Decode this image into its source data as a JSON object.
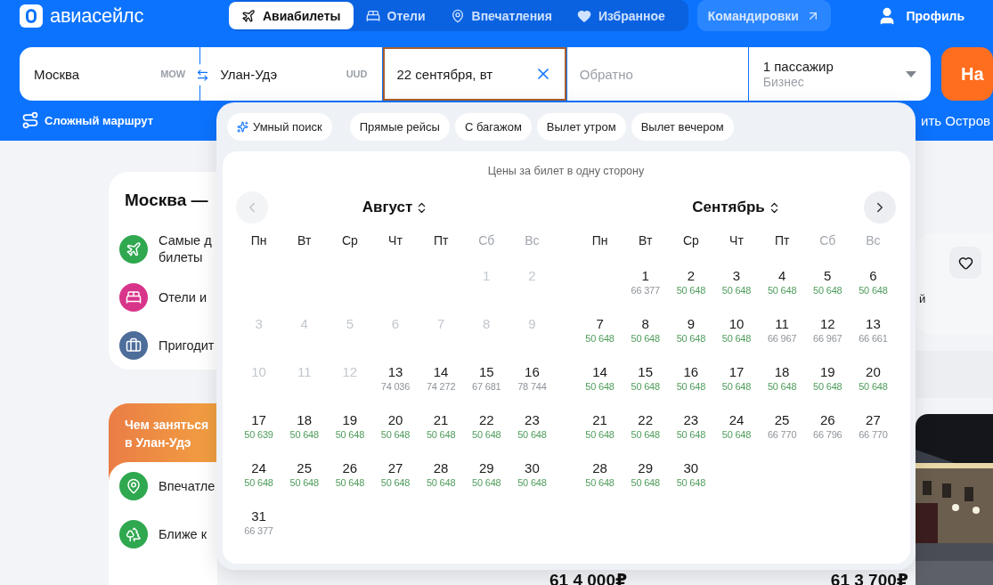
{
  "header": {
    "logo": "авиасейлс",
    "nav": [
      {
        "label": "Авиабилеты",
        "selected": true
      },
      {
        "label": "Отели",
        "selected": false
      },
      {
        "label": "Впечатления",
        "selected": false
      },
      {
        "label": "Избранное",
        "selected": false
      }
    ],
    "business_link": "Командировки",
    "profile": "Профиль"
  },
  "search": {
    "origin": {
      "value": "Москва",
      "code": "MOW"
    },
    "destination": {
      "value": "Улан-Удэ",
      "code": "UUD"
    },
    "depart": {
      "value": "22 сентября, вт",
      "active": true
    },
    "return": {
      "placeholder": "Обратно"
    },
    "passengers": {
      "value": "1 пассажир",
      "cabin": "Бизнес"
    },
    "submit": "На"
  },
  "complex_route": "Сложный маршрут",
  "side_link": "ить Остров",
  "route_card": {
    "title": "Москва —",
    "items": [
      {
        "lines": [
          "Самые д",
          "билеты"
        ]
      },
      {
        "lines": [
          "Отели и"
        ]
      },
      {
        "lines": [
          "Пригодит"
        ]
      }
    ]
  },
  "activities_card": {
    "title_lines": [
      "Чем заняться",
      "в Улан-Удэ"
    ],
    "items": [
      {
        "lines": [
          "Впечатле"
        ]
      },
      {
        "lines": [
          "Ближе к"
        ]
      }
    ]
  },
  "side_card": {
    "text": "й"
  },
  "prices": [
    "61 4 000₽",
    "61 3 700₽"
  ],
  "calendar": {
    "filters": [
      {
        "label": "Умный поиск",
        "kind": "smart"
      },
      {
        "label": "Прямые рейсы",
        "kind": "plain"
      },
      {
        "label": "С багажом",
        "kind": "plain"
      },
      {
        "label": "Вылет утром",
        "kind": "plain"
      },
      {
        "label": "Вылет вечером",
        "kind": "plain"
      }
    ],
    "caption": "Цены за билет в одну сторону",
    "prev_disabled": true,
    "next_disabled": false,
    "months": [
      {
        "title": "Август",
        "weekdays": [
          {
            "label": "Пн",
            "weekend": false
          },
          {
            "label": "Вт",
            "weekend": false
          },
          {
            "label": "Ср",
            "weekend": false
          },
          {
            "label": "Чт",
            "weekend": false
          },
          {
            "label": "Пт",
            "weekend": false
          },
          {
            "label": "Сб",
            "weekend": true
          },
          {
            "label": "Вс",
            "weekend": true
          }
        ],
        "weeks": [
          [
            {
              "kind": "blank"
            },
            {
              "kind": "blank"
            },
            {
              "kind": "blank"
            },
            {
              "kind": "blank"
            },
            {
              "kind": "blank"
            },
            {
              "kind": "day",
              "day": "1",
              "disabled": true
            },
            {
              "kind": "day",
              "day": "2",
              "disabled": true
            }
          ],
          [
            {
              "kind": "day",
              "day": "3",
              "disabled": true
            },
            {
              "kind": "day",
              "day": "4",
              "disabled": true
            },
            {
              "kind": "day",
              "day": "5",
              "disabled": true
            },
            {
              "kind": "day",
              "day": "6",
              "disabled": true
            },
            {
              "kind": "day",
              "day": "7",
              "disabled": true
            },
            {
              "kind": "day",
              "day": "8",
              "disabled": true
            },
            {
              "kind": "day",
              "day": "9",
              "disabled": true
            }
          ],
          [
            {
              "kind": "day",
              "day": "10",
              "disabled": true
            },
            {
              "kind": "day",
              "day": "11",
              "disabled": true
            },
            {
              "kind": "day",
              "day": "12",
              "disabled": true
            },
            {
              "kind": "day",
              "day": "13",
              "price": "74 036",
              "cheap": false,
              "disabled": false
            },
            {
              "kind": "day",
              "day": "14",
              "price": "74 272",
              "cheap": false,
              "disabled": false
            },
            {
              "kind": "day",
              "day": "15",
              "price": "67 681",
              "cheap": false,
              "disabled": false
            },
            {
              "kind": "day",
              "day": "16",
              "price": "78 744",
              "cheap": false,
              "disabled": false
            }
          ],
          [
            {
              "kind": "day",
              "day": "17",
              "price": "50 639",
              "cheap": true,
              "disabled": false
            },
            {
              "kind": "day",
              "day": "18",
              "price": "50 648",
              "cheap": true,
              "disabled": false
            },
            {
              "kind": "day",
              "day": "19",
              "price": "50 648",
              "cheap": true,
              "disabled": false
            },
            {
              "kind": "day",
              "day": "20",
              "price": "50 648",
              "cheap": true,
              "disabled": false
            },
            {
              "kind": "day",
              "day": "21",
              "price": "50 648",
              "cheap": true,
              "disabled": false
            },
            {
              "kind": "day",
              "day": "22",
              "price": "50 648",
              "cheap": true,
              "disabled": false
            },
            {
              "kind": "day",
              "day": "23",
              "price": "50 648",
              "cheap": true,
              "disabled": false
            }
          ],
          [
            {
              "kind": "day",
              "day": "24",
              "price": "50 648",
              "cheap": true,
              "disabled": false
            },
            {
              "kind": "day",
              "day": "25",
              "price": "50 648",
              "cheap": true,
              "disabled": false
            },
            {
              "kind": "day",
              "day": "26",
              "price": "50 648",
              "cheap": true,
              "disabled": false
            },
            {
              "kind": "day",
              "day": "27",
              "price": "50 648",
              "cheap": true,
              "disabled": false
            },
            {
              "kind": "day",
              "day": "28",
              "price": "50 648",
              "cheap": true,
              "disabled": false
            },
            {
              "kind": "day",
              "day": "29",
              "price": "50 648",
              "cheap": true,
              "disabled": false
            },
            {
              "kind": "day",
              "day": "30",
              "price": "50 648",
              "cheap": true,
              "disabled": false
            }
          ],
          [
            {
              "kind": "day",
              "day": "31",
              "price": "66 377",
              "cheap": false,
              "disabled": false
            }
          ]
        ]
      },
      {
        "title": "Сентябрь",
        "weekdays": [
          {
            "label": "Пн",
            "weekend": false
          },
          {
            "label": "Вт",
            "weekend": false
          },
          {
            "label": "Ср",
            "weekend": false
          },
          {
            "label": "Чт",
            "weekend": false
          },
          {
            "label": "Пт",
            "weekend": false
          },
          {
            "label": "Сб",
            "weekend": true
          },
          {
            "label": "Вс",
            "weekend": true
          }
        ],
        "weeks": [
          [
            {
              "kind": "blank"
            },
            {
              "kind": "day",
              "day": "1",
              "price": "66 377",
              "cheap": false,
              "disabled": false
            },
            {
              "kind": "day",
              "day": "2",
              "price": "50 648",
              "cheap": true,
              "disabled": false
            },
            {
              "kind": "day",
              "day": "3",
              "price": "50 648",
              "cheap": true,
              "disabled": false
            },
            {
              "kind": "day",
              "day": "4",
              "price": "50 648",
              "cheap": true,
              "disabled": false
            },
            {
              "kind": "day",
              "day": "5",
              "price": "50 648",
              "cheap": true,
              "disabled": false
            },
            {
              "kind": "day",
              "day": "6",
              "price": "50 648",
              "cheap": true,
              "disabled": false
            }
          ],
          [
            {
              "kind": "day",
              "day": "7",
              "price": "50 648",
              "cheap": true,
              "disabled": false
            },
            {
              "kind": "day",
              "day": "8",
              "price": "50 648",
              "cheap": true,
              "disabled": false
            },
            {
              "kind": "day",
              "day": "9",
              "price": "50 648",
              "cheap": true,
              "disabled": false
            },
            {
              "kind": "day",
              "day": "10",
              "price": "50 648",
              "cheap": true,
              "disabled": false
            },
            {
              "kind": "day",
              "day": "11",
              "price": "66 967",
              "cheap": false,
              "disabled": false
            },
            {
              "kind": "day",
              "day": "12",
              "price": "66 967",
              "cheap": false,
              "disabled": false
            },
            {
              "kind": "day",
              "day": "13",
              "price": "66 661",
              "cheap": false,
              "disabled": false
            }
          ],
          [
            {
              "kind": "day",
              "day": "14",
              "price": "50 648",
              "cheap": true,
              "disabled": false
            },
            {
              "kind": "day",
              "day": "15",
              "price": "50 648",
              "cheap": true,
              "disabled": false
            },
            {
              "kind": "day",
              "day": "16",
              "price": "50 648",
              "cheap": true,
              "disabled": false
            },
            {
              "kind": "day",
              "day": "17",
              "price": "50 648",
              "cheap": true,
              "disabled": false
            },
            {
              "kind": "day",
              "day": "18",
              "price": "50 648",
              "cheap": true,
              "disabled": false
            },
            {
              "kind": "day",
              "day": "19",
              "price": "50 648",
              "cheap": true,
              "disabled": false
            },
            {
              "kind": "day",
              "day": "20",
              "price": "50 648",
              "cheap": true,
              "disabled": false
            }
          ],
          [
            {
              "kind": "day",
              "day": "21",
              "price": "50 648",
              "cheap": true,
              "disabled": false
            },
            {
              "kind": "day",
              "day": "22",
              "price": "50 648",
              "cheap": true,
              "disabled": false
            },
            {
              "kind": "day",
              "day": "23",
              "price": "50 648",
              "cheap": true,
              "disabled": false
            },
            {
              "kind": "day",
              "day": "24",
              "price": "50 648",
              "cheap": true,
              "disabled": false
            },
            {
              "kind": "day",
              "day": "25",
              "price": "66 770",
              "cheap": false,
              "disabled": false
            },
            {
              "kind": "day",
              "day": "26",
              "price": "66 796",
              "cheap": false,
              "disabled": false
            },
            {
              "kind": "day",
              "day": "27",
              "price": "66 770",
              "cheap": false,
              "disabled": false
            }
          ],
          [
            {
              "kind": "day",
              "day": "28",
              "price": "50 648",
              "cheap": true,
              "disabled": false
            },
            {
              "kind": "day",
              "day": "29",
              "price": "50 648",
              "cheap": true,
              "disabled": false
            },
            {
              "kind": "day",
              "day": "30",
              "price": "50 648",
              "cheap": true,
              "disabled": false
            }
          ]
        ]
      }
    ]
  }
}
